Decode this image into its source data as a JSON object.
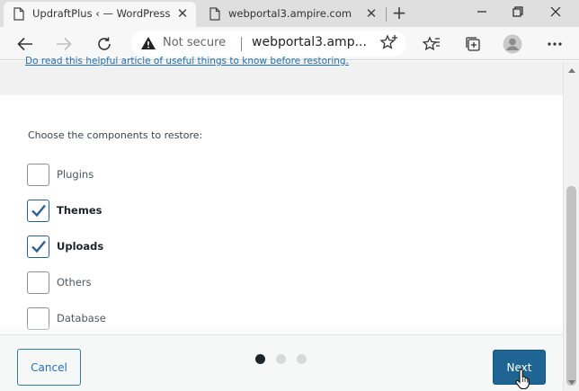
{
  "browser": {
    "tabs": [
      {
        "title": "UpdraftPlus ‹ — WordPress",
        "active": true
      },
      {
        "title": "webportal3.ampire.com",
        "active": false
      }
    ],
    "new_tab_label": "+",
    "address": {
      "security_text": "Not secure",
      "url": "webportal3.amp..."
    },
    "icons": {
      "page": "page-icon",
      "close": "close-icon",
      "back": "back-arrow-icon",
      "forward": "forward-arrow-icon",
      "reload": "reload-icon",
      "warning": "warning-icon",
      "favorite": "star-icon",
      "favorites_bar": "favorites-icon",
      "collections": "collections-icon",
      "profile": "profile-icon"
    }
  },
  "page": {
    "clipped_link": "Do read this helpful article of useful things to know before restoring.",
    "components_heading": "Choose the components to restore:",
    "components": [
      {
        "label": "Plugins",
        "checked": false
      },
      {
        "label": "Themes",
        "checked": true
      },
      {
        "label": "Uploads",
        "checked": true
      },
      {
        "label": "Others",
        "checked": false
      },
      {
        "label": "Database",
        "checked": false
      }
    ],
    "footer": {
      "cancel_label": "Cancel",
      "next_label": "Next",
      "steps_total": 3,
      "current_step": 1
    }
  },
  "colors": {
    "accent": "#2271b1",
    "next_button": "#1e6593",
    "checkbox_checked": "#2c5f94"
  }
}
